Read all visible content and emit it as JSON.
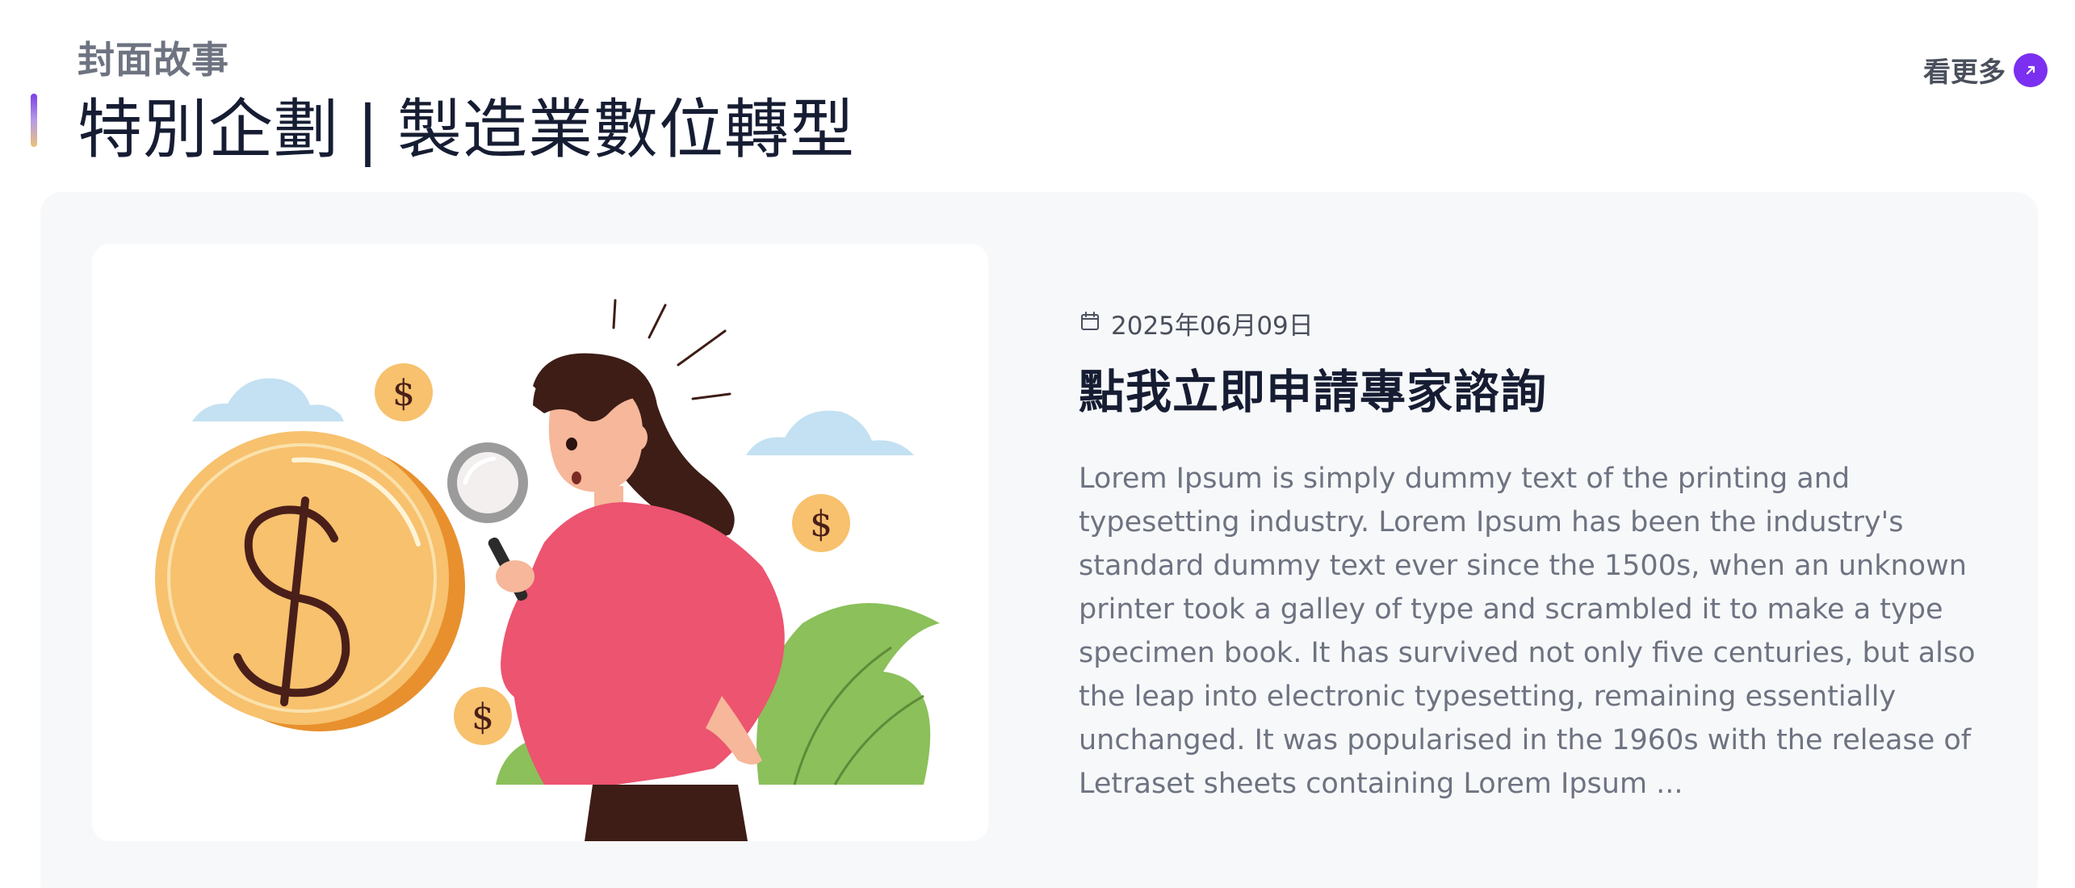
{
  "header": {
    "eyebrow": "封面故事",
    "title_part1": "特別企劃",
    "title_separator": "|",
    "title_part2": "製造業數位轉型",
    "more_label": "看更多"
  },
  "article": {
    "date": "2025年06月09日",
    "title": "點我立即申請專家諮詢",
    "excerpt": "Lorem Ipsum is simply dummy text of the printing and typesetting industry. Lorem Ipsum has been the industry's standard dummy text ever since the 1500s, when an unknown printer took a galley of type and scrambled it to make a type specimen book. It has survived not only five centuries, but also the leap into electronic typesetting, remaining essentially unchanged. It was popularised in the 1960s with the release of Letraset sheets containing Lorem Ipsum ...",
    "illustration": {
      "coin_symbol": "$",
      "icons": [
        "dollar-coin-icon",
        "magnifying-glass-icon",
        "cloud-icon",
        "leaf-icon"
      ]
    }
  },
  "icons": {
    "more": "arrow-up-right-icon",
    "date": "calendar-icon"
  },
  "colors": {
    "accent": "#7b2ff0",
    "title": "#161d33",
    "muted": "#6e7381",
    "card_bg": "#f7f8fa",
    "coin": "#f7c16e",
    "shirt": "#ec5470",
    "leaf": "#8bc05a",
    "cloud": "#c3e1f2"
  }
}
